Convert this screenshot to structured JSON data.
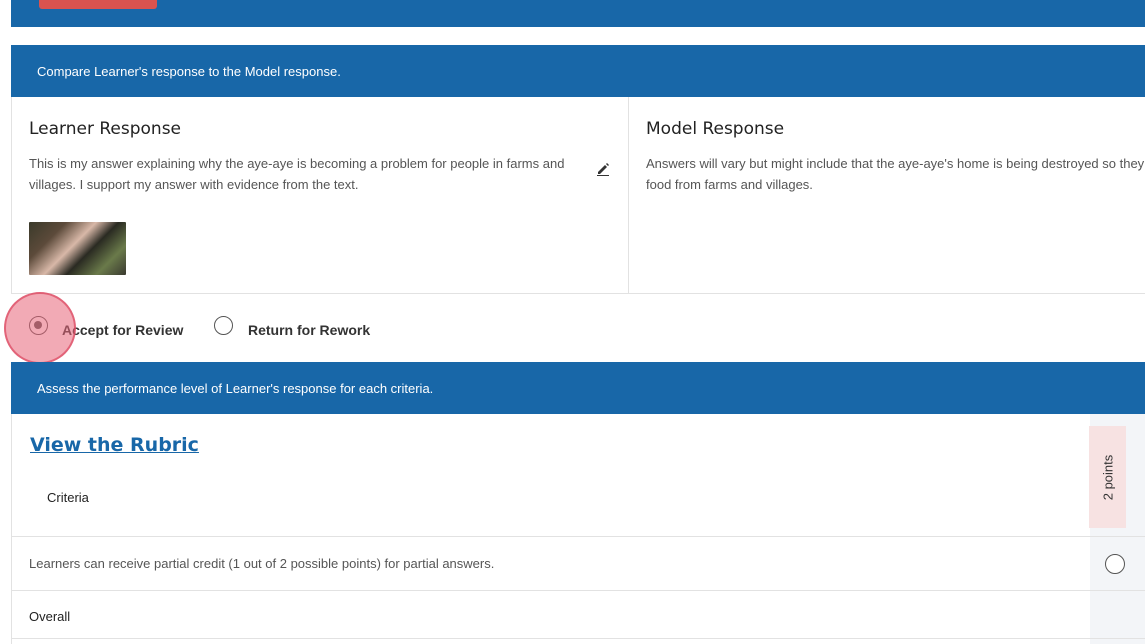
{
  "banners": {
    "compare": "Compare Learner's response to the Model response.",
    "assess": "Assess the performance level of Learner's response for each criteria."
  },
  "learner": {
    "title": "Learner Response",
    "text": "This is my answer explaining why the aye-aye is becoming a problem for people in farms and villages. I support my answer with evidence from the text."
  },
  "model": {
    "title": "Model Response",
    "text": "Answers will vary but might include that the aye-aye's home is being destroyed so they have to steal food from farms and villages."
  },
  "review": {
    "accept_label": "Accept for Review",
    "rework_label": "Return for Rework",
    "selected": "accept"
  },
  "rubric": {
    "link_text": "View the Rubric",
    "criteria_header": "Criteria",
    "points_header": "2 points",
    "rows": [
      {
        "text": "Learners can receive partial credit (1 out of 2 possible points) for partial answers."
      }
    ],
    "overall_label": "Overall"
  },
  "colors": {
    "primary": "#1867a8",
    "accent_red": "#d9534f",
    "badge_bg": "#f7e2e2"
  }
}
